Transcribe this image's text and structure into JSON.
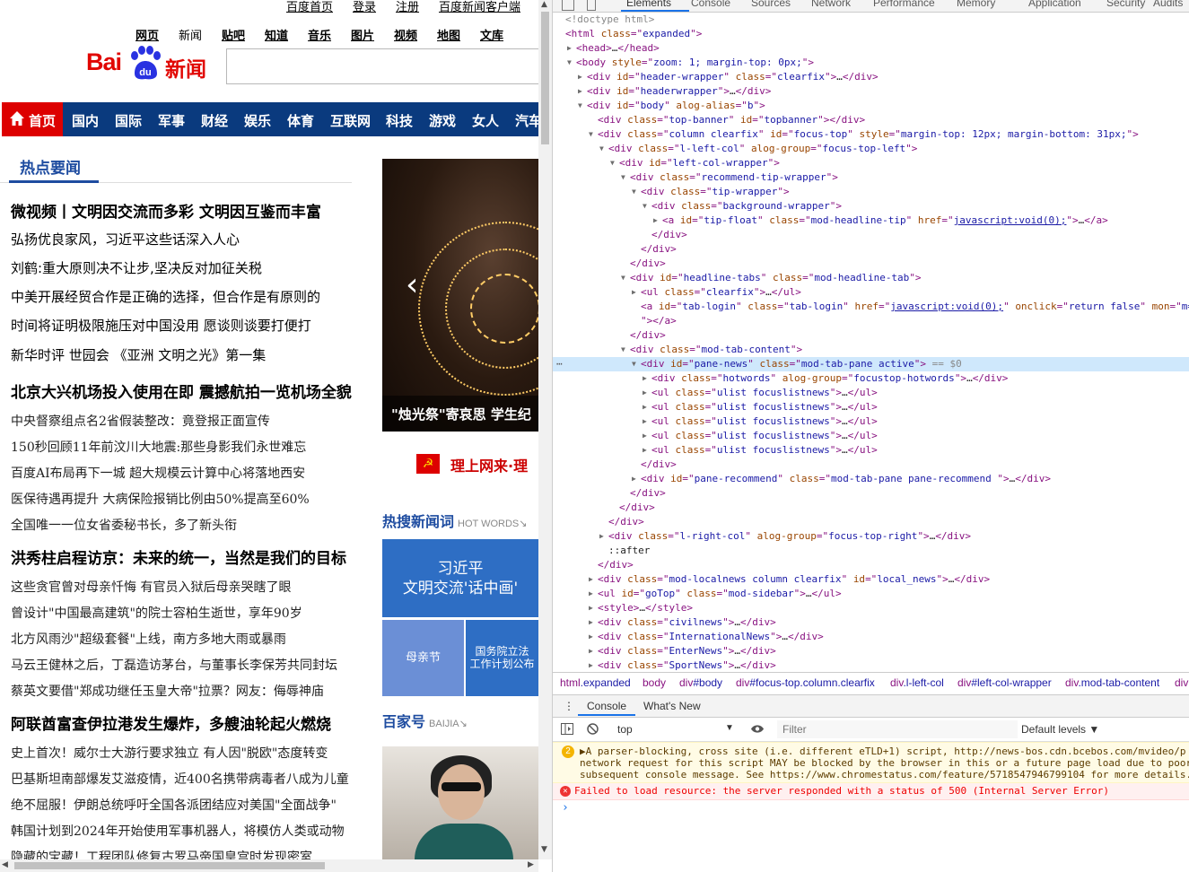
{
  "page": {
    "top_links": [
      "百度首页",
      "登录",
      "注册",
      "百度新闻客户端"
    ],
    "sub_nav": [
      "网页",
      "新闻",
      "贴吧",
      "知道",
      "音乐",
      "图片",
      "视频",
      "地图",
      "文库"
    ],
    "logo": {
      "bai": "Bai",
      "du": "du",
      "xinwen": "新闻"
    },
    "nav": {
      "home": "首页",
      "items": [
        "国内",
        "国际",
        "军事",
        "财经",
        "娱乐",
        "体育",
        "互联网",
        "科技",
        "游戏",
        "女人",
        "汽车"
      ]
    },
    "hot_news_title": "热点要闻",
    "headlines": [
      "微视频丨文明因交流而多彩 文明因互鉴而丰富",
      "弘扬优良家风，习近平这些话深入人心",
      "刘鹤:重大原则决不让步,坚决反对加征关税",
      "中美开展经贸合作是正确的选择，但合作是有原则的",
      "时间将证明极限施压对中国没用 愿谈则谈要打便打",
      "新华时评 世园会 《亚洲 文明之光》第一集",
      "北京大兴机场投入使用在即 震撼航拍一览机场全貌",
      "中央督察组点名2省假装整改：竟登报正面宣传",
      "150秒回顾11年前汶川大地震:那些身影我们永世难忘",
      "百度AI布局再下一城 超大规模云计算中心将落地西安",
      "医保待遇再提升 大病保险报销比例由50%提高至60%",
      "全国唯一一位女省委秘书长，多了新头衔",
      "洪秀柱启程访京：未来的统一，当然是我们的目标",
      "这些贪官曾对母亲忏悔 有官员入狱后母亲哭瞎了眼",
      "曾设计\"中国最高建筑\"的院士容柏生逝世，享年90岁",
      "北方风雨沙\"超级套餐\"上线，南方多地大雨或暴雨",
      "马云王健林之后，丁磊造访茅台，与董事长李保芳共同封坛",
      "蔡英文要借\"郑成功继任玉皇大帝\"拉票？网友：侮辱神庙",
      "阿联酋富查伊拉港发生爆炸，多艘油轮起火燃烧",
      "史上首次！威尔士大游行要求独立 有人因\"脱欧\"态度转变",
      "巴基斯坦南部爆发艾滋疫情，近400名携带病毒者八成为儿童",
      "绝不屈服！伊朗总统呼吁全国各派团结应对美国\"全面战争\"",
      "韩国计划到2024年开始使用军事机器人，将模仿人类或动物",
      "隐藏的宝藏！工程团队修复古罗马帝国皇宫时发现密室"
    ],
    "focus_caption": "\"烛光祭\"寄哀思 学生纪",
    "party_banner": "理上网来·理",
    "hot_search_title": "热搜新闻词",
    "hot_search_sub": "HOT WORDS",
    "hot_word_main": [
      "习近平",
      "文明交流'话中画'"
    ],
    "hot_word_tile1": "母亲节",
    "hot_word_tile2": [
      "国务院立法",
      "工作计划公布"
    ],
    "baijia_title": "百家号",
    "baijia_sub": "BAIJIA"
  },
  "devtools": {
    "tabs": [
      "Elements",
      "Console",
      "Sources",
      "Network",
      "Performance",
      "Memory",
      "Application",
      "Security",
      "Audits"
    ],
    "active_tab": "Elements",
    "dom_lines": [
      {
        "i": 0,
        "tri": "",
        "html": "<span class='gr'>&lt;!doctype html&gt;</span>"
      },
      {
        "i": 0,
        "tri": "",
        "html": "&lt;html <span class='an'>class</span>=\"<span class='av'>expanded</span>\"&gt;"
      },
      {
        "i": 1,
        "tri": "▶",
        "html": "&lt;head&gt;<span class='txt'>…</span>&lt;/head&gt;"
      },
      {
        "i": 1,
        "tri": "▼",
        "html": "&lt;body <span class='an'>style</span>=\"<span class='av'>zoom: 1; margin-top: 0px;</span>\"&gt;"
      },
      {
        "i": 2,
        "tri": "▶",
        "html": "&lt;div <span class='an'>id</span>=\"<span class='av'>header-wrapper</span>\" <span class='an'>class</span>=\"<span class='av'>clearfix</span>\"&gt;<span class='txt'>…</span>&lt;/div&gt;"
      },
      {
        "i": 2,
        "tri": "▶",
        "html": "&lt;div <span class='an'>id</span>=\"<span class='av'>headerwrapper</span>\"&gt;<span class='txt'>…</span>&lt;/div&gt;"
      },
      {
        "i": 2,
        "tri": "▼",
        "html": "&lt;div <span class='an'>id</span>=\"<span class='av'>body</span>\" <span class='an'>alog-alias</span>=\"<span class='av'>b</span>\"&gt;"
      },
      {
        "i": 3,
        "tri": "",
        "html": "&lt;div <span class='an'>class</span>=\"<span class='av'>top-banner</span>\" <span class='an'>id</span>=\"<span class='av'>topbanner</span>\"&gt;&lt;/div&gt;"
      },
      {
        "i": 3,
        "tri": "▼",
        "html": "&lt;div <span class='an'>class</span>=\"<span class='av'>column clearfix</span>\" <span class='an'>id</span>=\"<span class='av'>focus-top</span>\" <span class='an'>style</span>=\"<span class='av'>margin-top: 12px; margin-bottom: 31px;</span>\"&gt;"
      },
      {
        "i": 4,
        "tri": "▼",
        "html": "&lt;div <span class='an'>class</span>=\"<span class='av'>l-left-col</span>\" <span class='an'>alog-group</span>=\"<span class='av'>focus-top-left</span>\"&gt;"
      },
      {
        "i": 5,
        "tri": "▼",
        "html": "&lt;div <span class='an'>id</span>=\"<span class='av'>left-col-wrapper</span>\"&gt;"
      },
      {
        "i": 6,
        "tri": "▼",
        "html": "&lt;div <span class='an'>class</span>=\"<span class='av'>recommend-tip-wrapper</span>\"&gt;"
      },
      {
        "i": 7,
        "tri": "▼",
        "html": "&lt;div <span class='an'>class</span>=\"<span class='av'>tip-wrapper</span>\"&gt;"
      },
      {
        "i": 8,
        "tri": "▼",
        "html": "&lt;div <span class='an'>class</span>=\"<span class='av'>background-wrapper</span>\"&gt;"
      },
      {
        "i": 9,
        "tri": "▶",
        "html": "&lt;a <span class='an'>id</span>=\"<span class='av'>tip-float</span>\" <span class='an'>class</span>=\"<span class='av'>mod-headline-tip</span>\" <span class='an'>href</span>=\"<span class='lk'>javascript:void(0);</span>\"&gt;<span class='txt'>…</span>&lt;/a&gt;"
      },
      {
        "i": 8,
        "tri": "",
        "html": "&lt;/div&gt;"
      },
      {
        "i": 7,
        "tri": "",
        "html": "&lt;/div&gt;"
      },
      {
        "i": 6,
        "tri": "",
        "html": "&lt;/div&gt;"
      },
      {
        "i": 6,
        "tri": "▼",
        "html": "&lt;div <span class='an'>id</span>=\"<span class='av'>headline-tabs</span>\" <span class='an'>class</span>=\"<span class='av'>mod-headline-tab</span>\"&gt;"
      },
      {
        "i": 7,
        "tri": "▶",
        "html": "&lt;ul <span class='an'>class</span>=\"<span class='av'>clearfix</span>\"&gt;<span class='txt'>…</span>&lt;/ul&gt;"
      },
      {
        "i": 7,
        "tri": "",
        "html": "&lt;a <span class='an'>id</span>=\"<span class='av'>tab-login</span>\" <span class='an'>class</span>=\"<span class='av'>tab-login</span>\" <span class='an'>href</span>=\"<span class='lk'>javascript:void(0);</span>\" <span class='an'>onclick</span>=\"<span class='av'>return false</span>\" <span class='an'>mon</span>=\"<span class='av'>m=</span>"
      },
      {
        "i": 7,
        "tri": "",
        "html": "\"&gt;&lt;/a&gt;"
      },
      {
        "i": 6,
        "tri": "",
        "html": "&lt;/div&gt;"
      },
      {
        "i": 6,
        "tri": "▼",
        "html": "&lt;div <span class='an'>class</span>=\"<span class='av'>mod-tab-content</span>\"&gt;"
      },
      {
        "i": 7,
        "tri": "▼",
        "sel": true,
        "html": "&lt;div <span class='an'>id</span>=\"<span class='av'>pane-news</span>\" <span class='an'>class</span>=\"<span class='av'>mod-tab-pane active</span>\"&gt; <span class='gr'>== $0</span>"
      },
      {
        "i": 8,
        "tri": "▶",
        "html": "&lt;div <span class='an'>class</span>=\"<span class='av'>hotwords</span>\" <span class='an'>alog-group</span>=\"<span class='av'>focustop-hotwords</span>\"&gt;<span class='txt'>…</span>&lt;/div&gt;"
      },
      {
        "i": 8,
        "tri": "▶",
        "html": "&lt;ul <span class='an'>class</span>=\"<span class='av'>ulist focuslistnews</span>\"&gt;<span class='txt'>…</span>&lt;/ul&gt;"
      },
      {
        "i": 8,
        "tri": "▶",
        "html": "&lt;ul <span class='an'>class</span>=\"<span class='av'>ulist focuslistnews</span>\"&gt;<span class='txt'>…</span>&lt;/ul&gt;"
      },
      {
        "i": 8,
        "tri": "▶",
        "html": "&lt;ul <span class='an'>class</span>=\"<span class='av'>ulist focuslistnews</span>\"&gt;<span class='txt'>…</span>&lt;/ul&gt;"
      },
      {
        "i": 8,
        "tri": "▶",
        "html": "&lt;ul <span class='an'>class</span>=\"<span class='av'>ulist focuslistnews</span>\"&gt;<span class='txt'>…</span>&lt;/ul&gt;"
      },
      {
        "i": 8,
        "tri": "▶",
        "html": "&lt;ul <span class='an'>class</span>=\"<span class='av'>ulist focuslistnews</span>\"&gt;<span class='txt'>…</span>&lt;/ul&gt;"
      },
      {
        "i": 7,
        "tri": "",
        "html": "&lt;/div&gt;"
      },
      {
        "i": 7,
        "tri": "▶",
        "html": "&lt;div <span class='an'>id</span>=\"<span class='av'>pane-recommend</span>\" <span class='an'>class</span>=\"<span class='av'>mod-tab-pane pane-recommend </span>\"&gt;<span class='txt'>…</span>&lt;/div&gt;"
      },
      {
        "i": 6,
        "tri": "",
        "html": "&lt;/div&gt;"
      },
      {
        "i": 5,
        "tri": "",
        "html": "&lt;/div&gt;"
      },
      {
        "i": 4,
        "tri": "",
        "html": "&lt;/div&gt;"
      },
      {
        "i": 4,
        "tri": "▶",
        "html": "&lt;div <span class='an'>class</span>=\"<span class='av'>l-right-col</span>\" <span class='an'>alog-group</span>=\"<span class='av'>focus-top-right</span>\"&gt;<span class='txt'>…</span>&lt;/div&gt;"
      },
      {
        "i": 4,
        "tri": "",
        "html": "<span class='txt'>::after</span>"
      },
      {
        "i": 3,
        "tri": "",
        "html": "&lt;/div&gt;"
      },
      {
        "i": 3,
        "tri": "▶",
        "html": "&lt;div <span class='an'>class</span>=\"<span class='av'>mod-localnews column clearfix</span>\" <span class='an'>id</span>=\"<span class='av'>local_news</span>\"&gt;<span class='txt'>…</span>&lt;/div&gt;"
      },
      {
        "i": 3,
        "tri": "▶",
        "html": "&lt;ul <span class='an'>id</span>=\"<span class='av'>goTop</span>\" <span class='an'>class</span>=\"<span class='av'>mod-sidebar</span>\"&gt;<span class='txt'>…</span>&lt;/ul&gt;"
      },
      {
        "i": 3,
        "tri": "▶",
        "html": "&lt;style&gt;<span class='txt'>…</span>&lt;/style&gt;"
      },
      {
        "i": 3,
        "tri": "▶",
        "html": "&lt;div <span class='an'>class</span>=\"<span class='av'>civilnews</span>\"&gt;<span class='txt'>…</span>&lt;/div&gt;"
      },
      {
        "i": 3,
        "tri": "▶",
        "html": "&lt;div <span class='an'>class</span>=\"<span class='av'>InternationalNews</span>\"&gt;<span class='txt'>…</span>&lt;/div&gt;"
      },
      {
        "i": 3,
        "tri": "▶",
        "html": "&lt;div <span class='an'>class</span>=\"<span class='av'>EnterNews</span>\"&gt;<span class='txt'>…</span>&lt;/div&gt;"
      },
      {
        "i": 3,
        "tri": "▶",
        "html": "&lt;div <span class='an'>class</span>=\"<span class='av'>SportNews</span>\"&gt;<span class='txt'>…</span>&lt;/div&gt;"
      }
    ],
    "breadcrumbs": [
      {
        "tag": "html",
        "cls": ".expanded"
      },
      {
        "tag": "body",
        "cls": ""
      },
      {
        "tag": "div",
        "cls": "#body"
      },
      {
        "tag": "div",
        "cls": "#focus-top.column.clearfix"
      },
      {
        "tag": "div",
        "cls": ".l-left-col"
      },
      {
        "tag": "div",
        "cls": "#left-col-wrapper"
      },
      {
        "tag": "div",
        "cls": ".mod-tab-content"
      },
      {
        "tag": "div",
        "cls": ""
      }
    ],
    "drawer_tabs": [
      "Console",
      "What's New"
    ],
    "console": {
      "context": "top",
      "filter_placeholder": "Filter",
      "levels": "Default levels ▼",
      "warn_count": "2",
      "warning_lines": [
        "▶A parser-blocking, cross site (i.e. different eTLD+1) script, http://news-bos.cdn.bcebos.com/mvideo/p",
        "network request for this script MAY be blocked by the browser in this or a future page load due to poor",
        "subsequent console message. See https://www.chromestatus.com/feature/5718547946799104 for more details."
      ],
      "error": "Failed to load resource: the server responded with a status of 500 (Internal Server Error)",
      "prompt": "›"
    }
  }
}
